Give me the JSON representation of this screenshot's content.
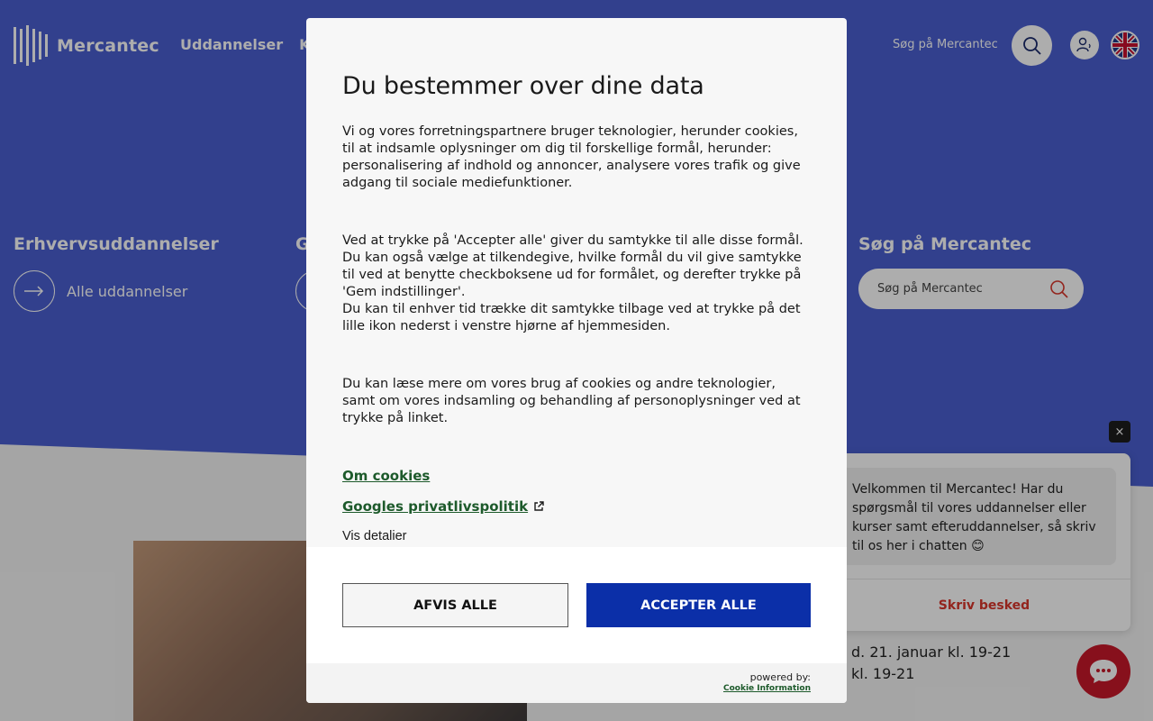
{
  "header": {
    "logo_text": "Mercantec",
    "nav": [
      "Uddannelser",
      "Ku"
    ],
    "search_label": "Søg på Mercantec",
    "search_icon": "search-icon",
    "accessibility_icon": "person-speaker-icon",
    "language_icon": "uk-flag-icon"
  },
  "hero": {
    "col1_title": "Erhvervsuddannelser",
    "col1_link": "Alle uddannelser",
    "col2_title": "G",
    "search_title": "Søg på Mercantec",
    "search_placeholder": "Søg på Mercantec"
  },
  "events": {
    "line1": "d. 21. januar kl. 19-21",
    "line2": "kl. 19-21"
  },
  "chat": {
    "welcome": "Velkommen til Mercantec! Har du spørgsmål til vores uddannelser eller kurser samt efteruddannelser, så skriv til os her i chatten 😊",
    "write_label": "Skriv besked",
    "close_label": "×"
  },
  "cookie": {
    "title": "Du bestemmer over dine data",
    "p1": "Vi og vores forretningspartnere bruger teknologier, herunder cookies, til at indsamle oplysninger om dig til forskellige formål, herunder: personalisering af indhold og annoncer, analysere vores trafik og give adgang til sociale mediefunktioner.",
    "p2a": "Ved at trykke på 'Accepter alle' giver du samtykke til alle disse formål. Du kan også vælge at tilkendegive, hvilke formål du vil give samtykke til ved at benytte checkboksene ud for formålet, og derefter trykke på 'Gem indstillinger'.",
    "p2b": "Du kan til enhver tid trække dit samtykke tilbage ved at trykke på det lille ikon nederst i venstre hjørne af hjemmesiden.",
    "p3": "Du kan læse mere om vores brug af cookies og andre teknologier, samt om vores indsamling og behandling af personoplysninger ved at trykke på linket.",
    "link_about": "Om cookies",
    "link_google": "Googles privatlivspolitik",
    "show_details": "Vis detalier",
    "reject_label": "AFVIS ALLE",
    "accept_label": "ACCEPTER ALLE",
    "powered_by": "powered by:",
    "provider": "Cookie Information",
    "accent_color": "#0b2fa8",
    "link_color": "#1d5a2b"
  }
}
